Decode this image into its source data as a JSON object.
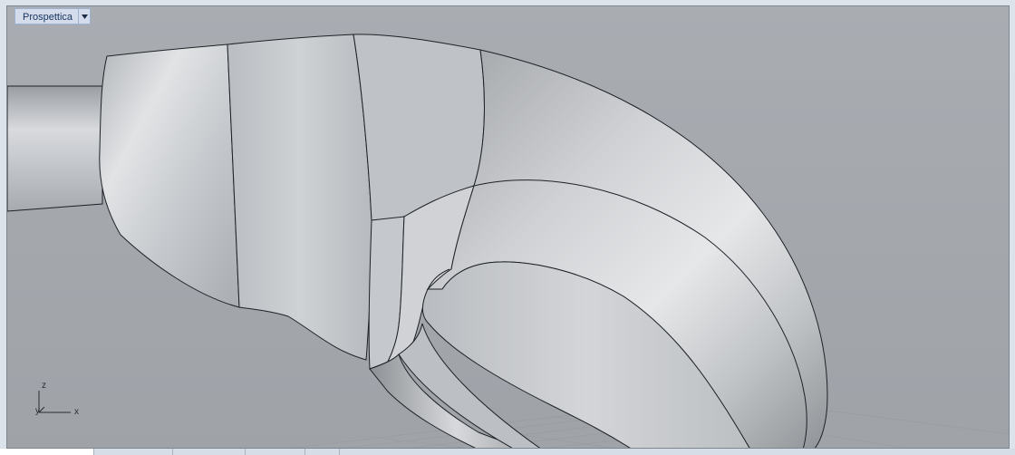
{
  "viewport": {
    "title": "Prospettica",
    "menu_icon": "dropdown-arrow-icon"
  },
  "axes": {
    "z_label": "z",
    "y_label": "y",
    "x_label": "x"
  },
  "colors": {
    "viewport_bg": "#a4a8ad",
    "model_surface": "#c8cbcf",
    "edge": "#1e2226",
    "title_bg": "#d4dceb"
  }
}
